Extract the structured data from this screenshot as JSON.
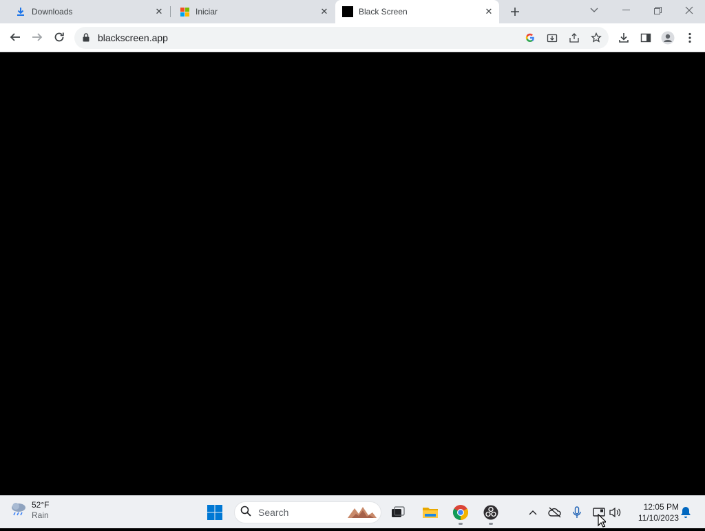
{
  "browser": {
    "tabs": [
      {
        "title": "Downloads",
        "favicon": "download-icon"
      },
      {
        "title": "Iniciar",
        "favicon": "microsoft-logo-icon"
      },
      {
        "title": "Black Screen",
        "favicon": "black-square-icon"
      }
    ],
    "active_tab_index": 2,
    "address": "blackscreen.app",
    "page_background": "#000000"
  },
  "taskbar": {
    "weather": {
      "temperature": "52°F",
      "condition": "Rain"
    },
    "search_placeholder": "Search",
    "clock": {
      "time": "12:05 PM",
      "date": "11/10/2023"
    }
  },
  "colors": {
    "tabstrip": "#dee1e6",
    "toolbar": "#ffffff",
    "taskbar": "#eef0f3",
    "windows_accent": "#0078d4"
  }
}
